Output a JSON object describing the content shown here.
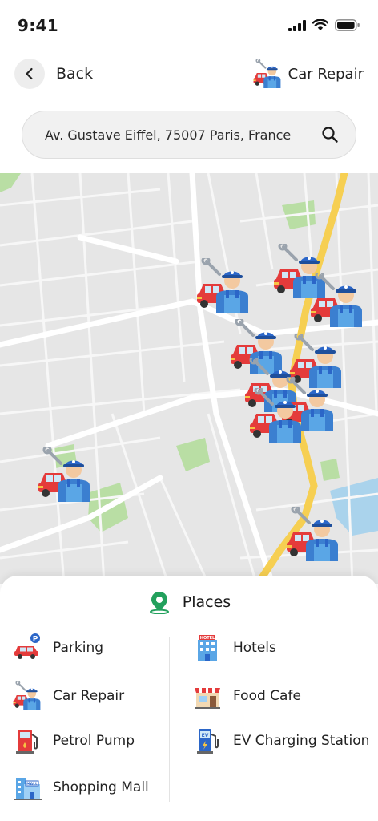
{
  "status_bar": {
    "time": "9:41"
  },
  "header": {
    "back_label": "Back",
    "category_label": "Car Repair",
    "category_icon": "mechanic-icon"
  },
  "search": {
    "value": "Av. Gustave Eiffel, 75007 Paris, France",
    "icon": "search-icon"
  },
  "map": {
    "marker_icon": "car-repair-mechanic-icon",
    "marker_count": 10
  },
  "places": {
    "title": "Places",
    "title_icon": "location-pin-icon",
    "left": [
      {
        "label": "Parking",
        "icon": "parking-icon"
      },
      {
        "label": "Car Repair",
        "icon": "mechanic-icon"
      },
      {
        "label": "Petrol Pump",
        "icon": "fuel-pump-icon"
      },
      {
        "label": "Shopping Mall",
        "icon": "mall-icon"
      }
    ],
    "right": [
      {
        "label": "Hotels",
        "icon": "hotel-icon"
      },
      {
        "label": "Food Cafe",
        "icon": "cafe-icon"
      },
      {
        "label": "EV Charging Station",
        "icon": "ev-charger-icon"
      }
    ]
  },
  "colors": {
    "map_background": "#e6e6e6",
    "highway": "#f6cf52",
    "park": "#b9dea4",
    "water": "#aad3ec",
    "pin_green": "#22a05c"
  }
}
